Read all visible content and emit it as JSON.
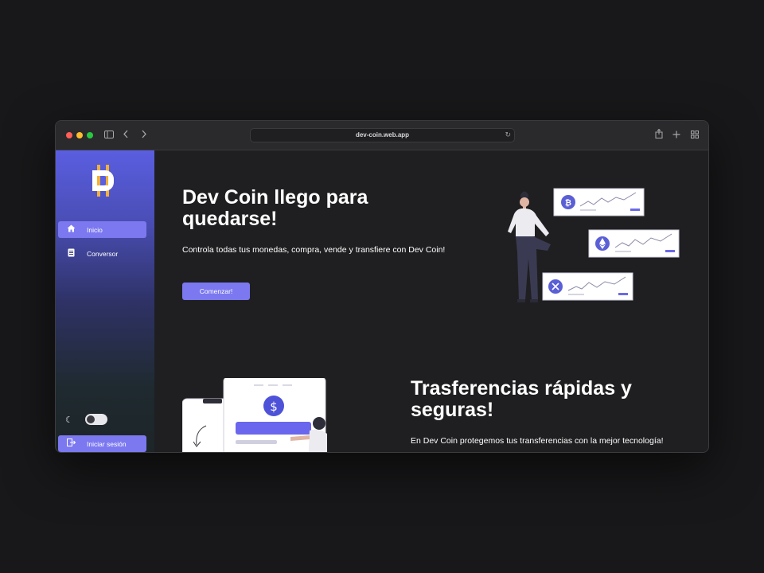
{
  "browser": {
    "url": "dev-coin.web.app",
    "icons": [
      "sidebar-toggle-icon",
      "back-icon",
      "forward-icon",
      "reload-icon",
      "share-icon",
      "new-tab-icon",
      "tab-overview-icon"
    ]
  },
  "sidebar": {
    "logo": "dev-coin-logo",
    "items": [
      {
        "label": "Inicio",
        "icon": "home-icon",
        "active": true
      },
      {
        "label": "Conversor",
        "icon": "document-icon",
        "active": false
      }
    ],
    "login_label": "Iniciar sesión"
  },
  "hero": {
    "title": "Dev Coin llego para quedarse!",
    "subtitle": "Controla todas tus monedas, compra, vende y transfiere con Dev Coin!",
    "cta_label": "Comenzar!"
  },
  "section2": {
    "title": "Trasferencias rápidas y seguras!",
    "subtitle": "En Dev Coin protegemos tus transferencias con la mejor tecnología!"
  },
  "colors": {
    "accent": "#7b78f0",
    "background": "#1f1f21",
    "sidebar_top": "#5a5ee0"
  }
}
